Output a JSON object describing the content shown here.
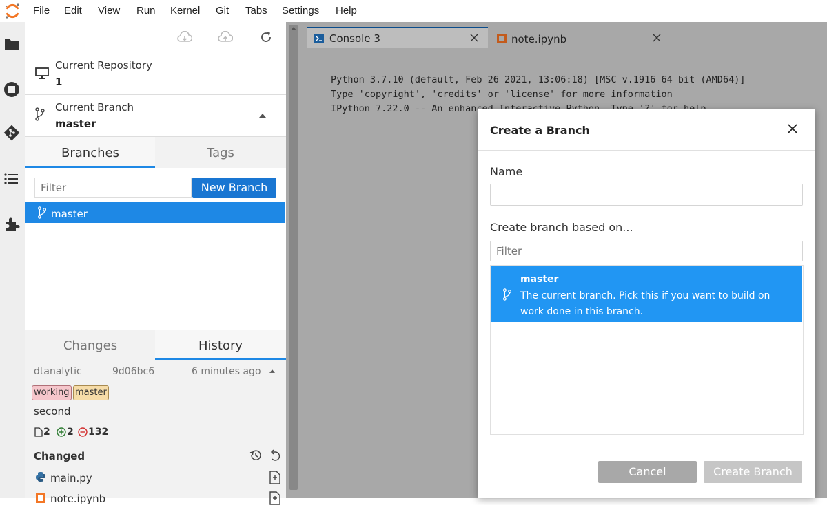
{
  "menubar": {
    "items": [
      "File",
      "Edit",
      "View",
      "Run",
      "Kernel",
      "Git",
      "Tabs",
      "Settings",
      "Help"
    ]
  },
  "activity_bar": {
    "icons": [
      "folder-icon",
      "running-icon",
      "git-icon",
      "toc-icon",
      "extension-icon"
    ]
  },
  "git_panel": {
    "toolbar_icons": [
      "pull-icon",
      "push-icon",
      "refresh-icon"
    ],
    "current_repository_label": "Current Repository",
    "current_repository_value": "1",
    "current_branch_label": "Current Branch",
    "current_branch_value": "master",
    "branch_tabs": [
      "Branches",
      "Tags"
    ],
    "filter_placeholder": "Filter",
    "new_branch_label": "New Branch",
    "branches": [
      "master"
    ],
    "lower_tabs": [
      "Changes",
      "History"
    ],
    "commit": {
      "author": "dtanalytic",
      "hash": "9d06bc6",
      "time": "6 minutes ago",
      "tags": [
        "working",
        "master"
      ],
      "message": "second",
      "files_changed": "2",
      "insertions": "2",
      "deletions": "132"
    },
    "changed_header": "Changed",
    "changed_files": [
      "main.py",
      "note.ipynb"
    ]
  },
  "doc_tabs": [
    {
      "label": "Console 3",
      "icon": "console-icon",
      "active": true
    },
    {
      "label": "note.ipynb",
      "icon": "notebook-icon",
      "active": false
    }
  ],
  "console": {
    "lines": [
      "Python 3.7.10 (default, Feb 26 2021, 13:06:18) [MSC v.1916 64 bit (AMD64)]",
      "Type 'copyright', 'credits' or 'license' for more information",
      "IPython 7.22.0 -- An enhanced Interactive Python. Type '?' for help."
    ]
  },
  "dialog": {
    "title": "Create a Branch",
    "name_label": "Name",
    "name_value": "",
    "based_on_label": "Create branch based on...",
    "filter_placeholder": "Filter",
    "selected_branch_name": "master",
    "selected_branch_desc": "The current branch. Pick this if you want to build on work done in this branch.",
    "cancel_label": "Cancel",
    "create_label": "Create Branch"
  },
  "colors": {
    "accent": "#1e88e5",
    "selected_row": "#1e88e5",
    "dialog_selected": "#2196f3",
    "button_disabled": "#aaaaaa",
    "tag_working": "#f5c6cb",
    "tag_master": "#f6dca8",
    "insert_green": "#2e7d32",
    "delete_red": "#d32f2f"
  }
}
